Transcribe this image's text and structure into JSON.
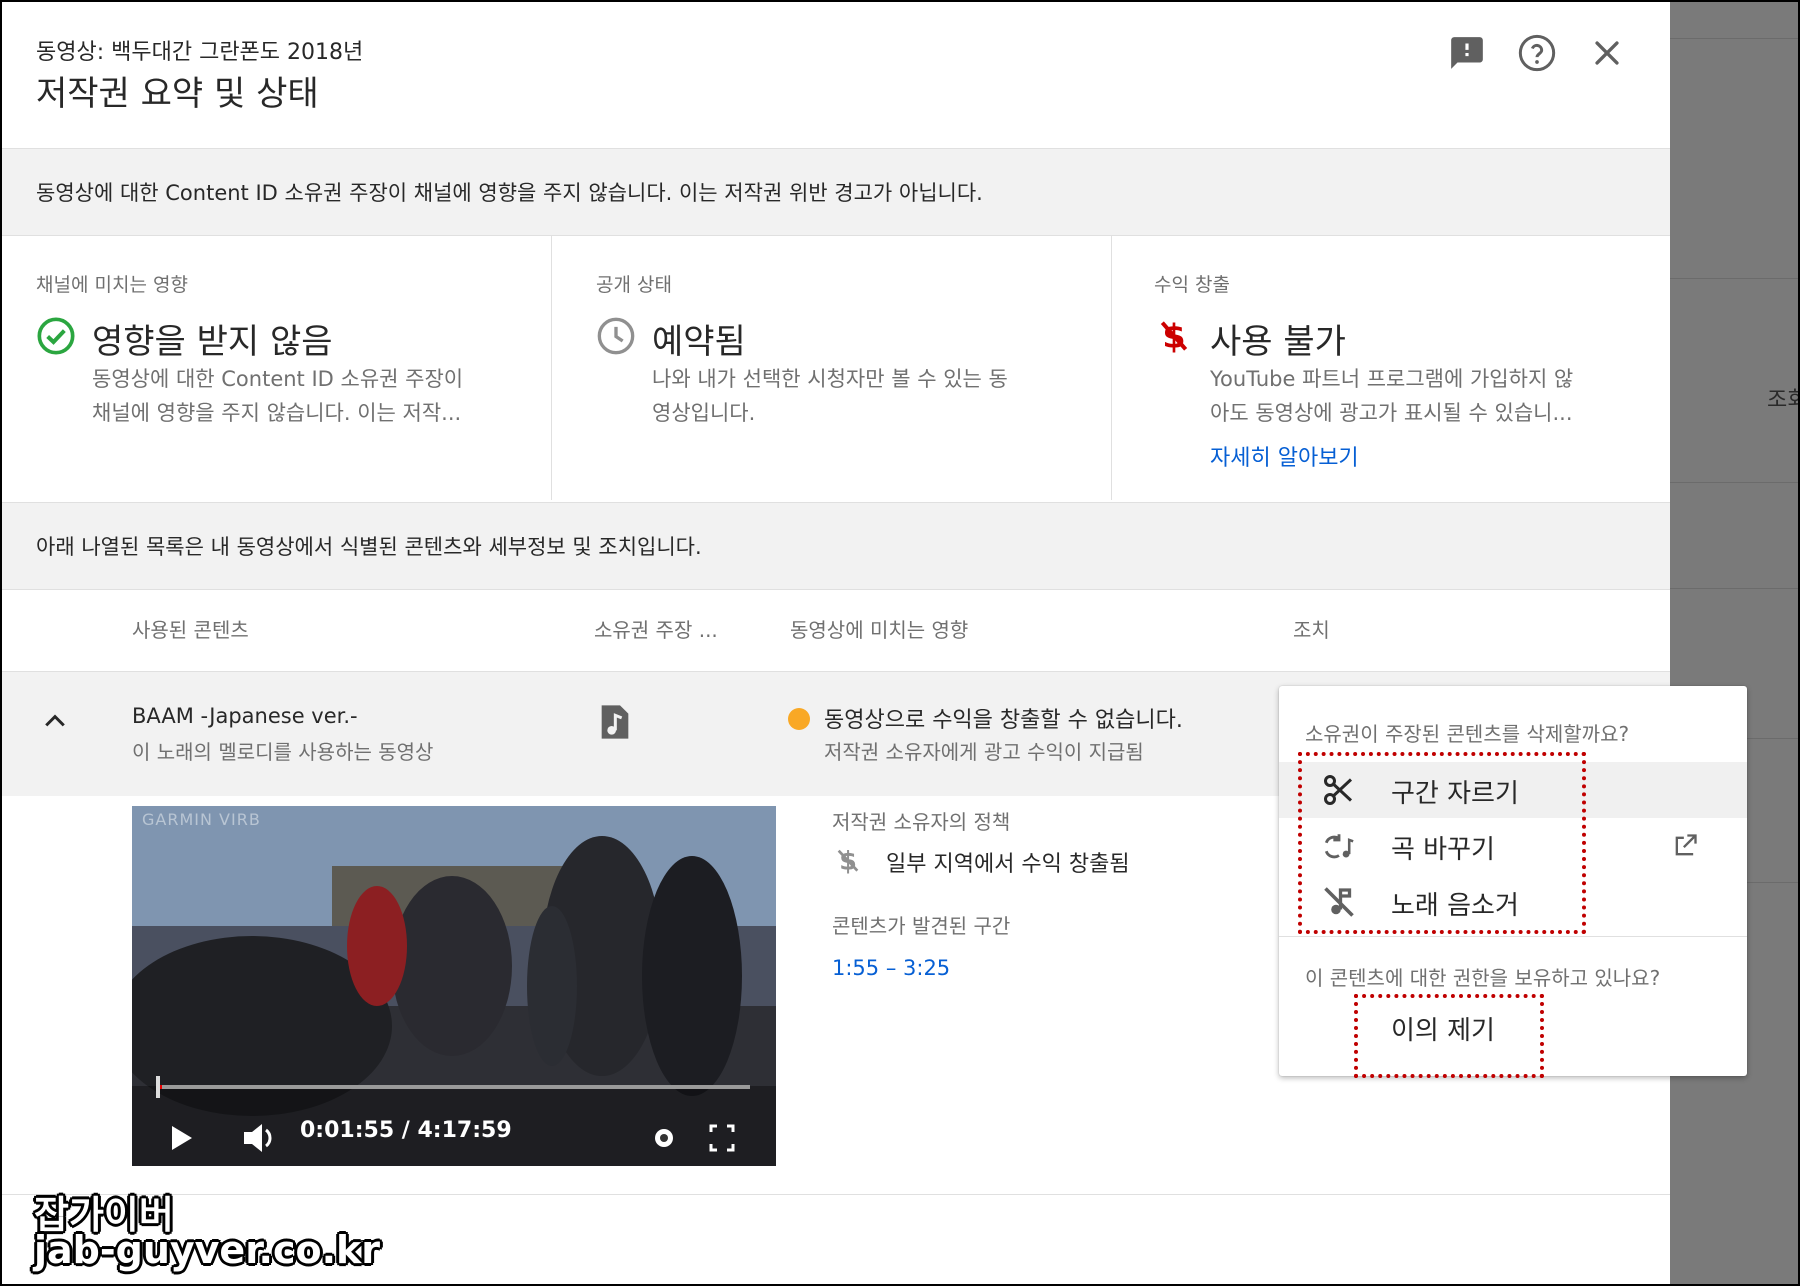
{
  "header": {
    "subtitle": "동영상: 백두대간 그란폰도 2018년",
    "title": "저작권 요약 및 상태"
  },
  "notice": "동영상에 대한 Content ID 소유권 주장이 채널에 영향을 주지 않습니다. 이는 저작권 위반 경고가 아닙니다.",
  "cards": [
    {
      "label": "채널에 미치는 영향",
      "title": "영향을 받지 않음",
      "desc_line1": "동영상에 대한 Content ID 소유권 주장이",
      "desc_line2": "채널에 영향을 주지 않습니다. 이는 저작...",
      "icon": "check-circle-icon",
      "icon_color": "#2ba640"
    },
    {
      "label": "공개 상태",
      "title": "예약됨",
      "desc_line1": "나와 내가 선택한 시청자만 볼 수 있는 동",
      "desc_line2": "영상입니다.",
      "icon": "clock-icon",
      "icon_color": "#909090"
    },
    {
      "label": "수익 창출",
      "title": "사용 불가",
      "desc_line1": "YouTube 파트너 프로그램에 가입하지 않",
      "desc_line2": "아도 동영상에 광고가 표시될 수 있습니...",
      "link": "자세히 알아보기",
      "icon": "no-monetization-icon",
      "icon_color": "#cc0000"
    }
  ],
  "list_notice": "아래 나열된 목록은 내 동영상에서 식별된 콘텐츠와 세부정보 및 조치입니다.",
  "table": {
    "headers": [
      "사용된 콘텐츠",
      "소유권 주장 ...",
      "동영상에 미치는 영향",
      "조치"
    ]
  },
  "claim": {
    "title": "BAAM -Japanese ver.-",
    "subtitle": "이 노래의 멜로디를 사용하는 동영상",
    "content_type_icon": "music-note-icon",
    "impact_title": "동영상으로 수익을 창출할 수 없습니다.",
    "impact_desc": "저작권 소유자에게 광고 수익이 지급됨",
    "impact_dot_color": "#f9a825",
    "policy_label": "저작권 소유자의 정책",
    "policy_value": "일부 지역에서 수익 창출됨",
    "segment_label": "콘텐츠가 발견된 구간",
    "segment_value": "1:55 – 3:25"
  },
  "video": {
    "watermark": "GARMIN VIRB",
    "time": "0:01:55 / 4:17:59"
  },
  "dropdown": {
    "question1": "소유권이 주장된 콘텐츠를 삭제할까요?",
    "items": [
      "구간 자르기",
      "곡 바꾸기",
      "노래 음소거"
    ],
    "question2": "이 콘텐츠에 대한 권한을 보유하고 있나요?",
    "dispute": "이의 제기"
  },
  "background_text": "조회",
  "site_watermark": {
    "line1": "잡가이버",
    "line2": "jab-guyver.co.kr"
  }
}
